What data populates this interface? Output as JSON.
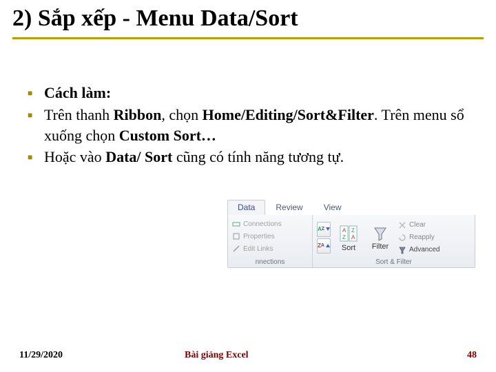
{
  "title": "2) Sắp xếp - Menu Data/Sort",
  "bullets": [
    {
      "pre": "",
      "bold": "Cách làm:",
      "post": ""
    },
    {
      "pre": "Trên thanh ",
      "bold": "Ribbon",
      "post": ", chọn ",
      "bold2": "Home/Editing/Sort&Filter",
      "post2": ". Trên menu sổ xuống chọn ",
      "bold3": "Custom Sort…",
      "post3": ""
    },
    {
      "pre": "Hoặc vào ",
      "bold": "Data/ Sort",
      "post": " cũng có tính năng tương tự."
    }
  ],
  "ribbon": {
    "tabs": [
      "Data",
      "Review",
      "View"
    ],
    "activeTab": 0,
    "connections": {
      "row1": "Connections",
      "row2": "Properties",
      "row3": "Edit Links",
      "label": "nnections"
    },
    "sort": {
      "sortLabel": "Sort",
      "filterLabel": "Filter",
      "opt1": "Clear",
      "opt2": "Reapply",
      "opt3": "Advanced",
      "groupLabel": "Sort & Filter"
    }
  },
  "footer": {
    "date": "11/29/2020",
    "title": "Bài giảng Excel",
    "page": "48"
  }
}
